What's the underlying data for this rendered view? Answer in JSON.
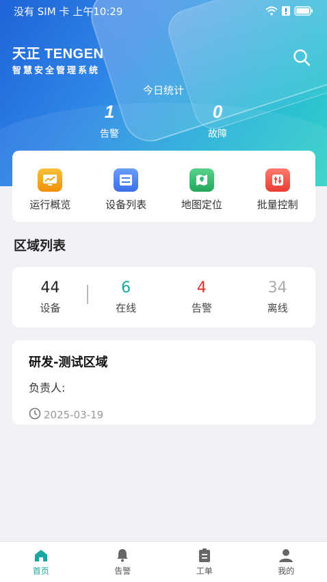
{
  "status_bar": {
    "left_text": "没有 SIM 卡 上午10:29"
  },
  "brand": {
    "name": "天正 TENGEN",
    "tagline": "智慧安全管理系统"
  },
  "today": {
    "title": "今日统计",
    "alarm_value": "1",
    "alarm_label": "告警",
    "fault_value": "0",
    "fault_label": "故障"
  },
  "quick_menu": [
    {
      "label": "运行概览",
      "icon": "chart-icon",
      "color": "#f2a312"
    },
    {
      "label": "设备列表",
      "icon": "list-icon",
      "color": "#3f7cf0"
    },
    {
      "label": "地图定位",
      "icon": "map-icon",
      "color": "#2dbb6e"
    },
    {
      "label": "批量控制",
      "icon": "control-icon",
      "color": "#ee4f44"
    }
  ],
  "region_list": {
    "title": "区域列表"
  },
  "counts": [
    {
      "value": "44",
      "label": "设备",
      "color": "#222222"
    },
    {
      "value": "6",
      "label": "在线",
      "color": "#1aa6a0"
    },
    {
      "value": "4",
      "label": "告警",
      "color": "#e0332a"
    },
    {
      "value": "34",
      "label": "离线",
      "color": "#aaaaaa"
    }
  ],
  "region_card": {
    "title": "研发-测试区域",
    "owner_label": "负责人:",
    "date": "2025-03-19"
  },
  "tabs": [
    {
      "label": "首页",
      "icon": "home-icon",
      "active": true
    },
    {
      "label": "告警",
      "icon": "bell-icon",
      "active": false
    },
    {
      "label": "工单",
      "icon": "clipboard-icon",
      "active": false
    },
    {
      "label": "我的",
      "icon": "user-icon",
      "active": false
    }
  ],
  "colors": {
    "accent": "#1aa6a0",
    "tab_inactive": "#555555"
  }
}
